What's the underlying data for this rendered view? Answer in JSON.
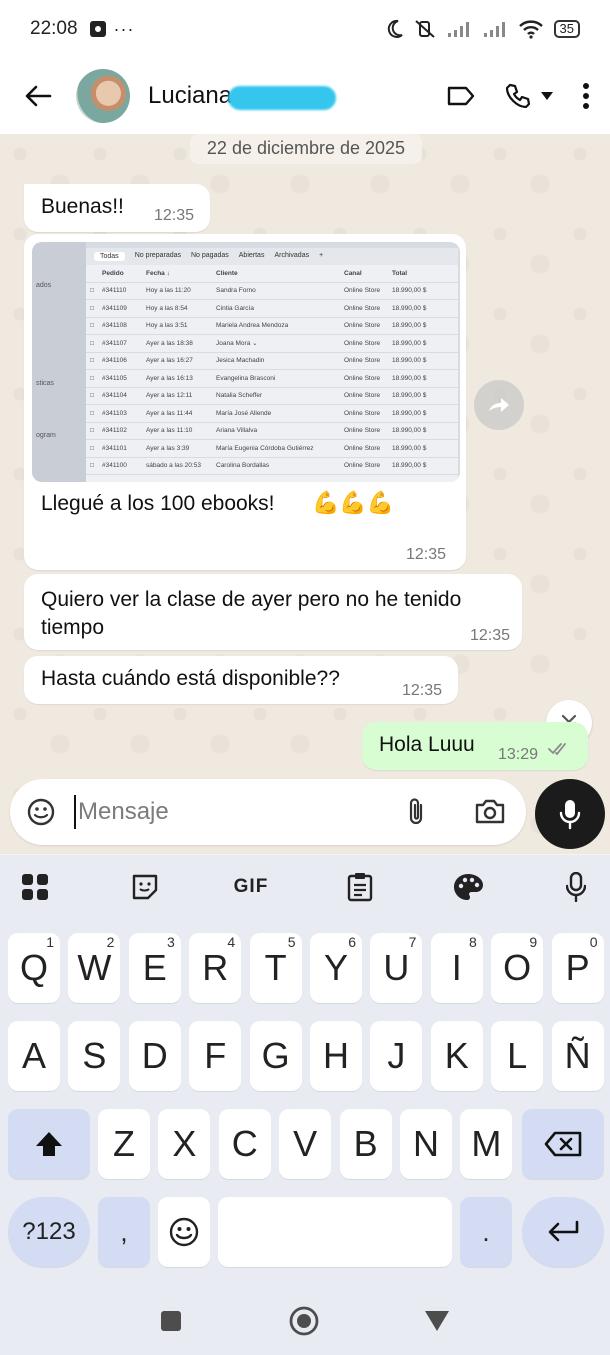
{
  "status_bar": {
    "time": "22:08",
    "dots": "···",
    "battery": "35"
  },
  "header": {
    "contact_name": "Luciana"
  },
  "chat": {
    "date": "22 de diciembre de 2025",
    "messages": [
      {
        "text": "Buenas!!",
        "time": "12:35"
      },
      {
        "caption": "Llegué a los 100 ebooks!",
        "emoji": "💪💪💪",
        "time": "12:35"
      },
      {
        "text": "Quiero ver la clase de ayer pero no he tenido tiempo",
        "time": "12:35"
      },
      {
        "text": "Hasta cuándo está disponible??",
        "time": "12:35"
      },
      {
        "text": "Hola Luuu",
        "time": "13:29",
        "outgoing": true
      }
    ],
    "screenshot_sheet": {
      "tabs": [
        "Todas",
        "No preparadas",
        "No pagadas",
        "Abiertas",
        "Archivadas",
        "+"
      ],
      "side_labels": [
        "ados",
        "sticas",
        "ogram"
      ],
      "columns": [
        "",
        "Pedido",
        "Fecha ↓",
        "Cliente",
        "Canal",
        "Total"
      ],
      "rows": [
        [
          "#341110",
          "Hoy a las 11:20",
          "Sandra Forno",
          "Online Store",
          "18.990,00 $"
        ],
        [
          "#341109",
          "Hoy a las 8:54",
          "Cintia García",
          "Online Store",
          "18.990,00 $"
        ],
        [
          "#341108",
          "Hoy a las 3:51",
          "Mariela Andrea Mendoza",
          "Online Store",
          "18.990,00 $"
        ],
        [
          "#341107",
          "Ayer a las 18:38",
          "Joana Mora ⌄",
          "Online Store",
          "18.990,00 $"
        ],
        [
          "#341106",
          "Ayer a las 16:27",
          "Jesica Machadin",
          "Online Store",
          "18.990,00 $"
        ],
        [
          "#341105",
          "Ayer a las 16:13",
          "Evangelina Brasconi",
          "Online Store",
          "18.990,00 $"
        ],
        [
          "#341104",
          "Ayer a las 12:11",
          "Natalia Scheffer",
          "Online Store",
          "18.990,00 $"
        ],
        [
          "#341103",
          "Ayer a las 11:44",
          "María José Allende",
          "Online Store",
          "18.990,00 $"
        ],
        [
          "#341102",
          "Ayer a las 11:10",
          "Ariana Villalva",
          "Online Store",
          "18.990,00 $"
        ],
        [
          "#341101",
          "Ayer a las 3:39",
          "María Eugenia Córdoba Gutiérrez",
          "Online Store",
          "18.990,00 $"
        ],
        [
          "#341100",
          "sábado a las 20:53",
          "Carolina Bordallas",
          "Online Store",
          "18.990,00 $"
        ]
      ]
    }
  },
  "composer": {
    "placeholder": "Mensaje"
  },
  "keyboard": {
    "toolbar_gif": "GIF",
    "row1": [
      [
        "Q",
        "1"
      ],
      [
        "W",
        "2"
      ],
      [
        "E",
        "3"
      ],
      [
        "R",
        "4"
      ],
      [
        "T",
        "5"
      ],
      [
        "Y",
        "6"
      ],
      [
        "U",
        "7"
      ],
      [
        "I",
        "8"
      ],
      [
        "O",
        "9"
      ],
      [
        "P",
        "0"
      ]
    ],
    "row2": [
      "A",
      "S",
      "D",
      "F",
      "G",
      "H",
      "J",
      "K",
      "L",
      "Ñ"
    ],
    "row3": [
      "Z",
      "X",
      "C",
      "V",
      "B",
      "N",
      "M"
    ],
    "symbols_key": "?123",
    "comma_key": ",",
    "period_key": "."
  },
  "colors": {
    "chat_bg": "#efe9e0",
    "incoming_bubble": "#ffffff",
    "outgoing_bubble": "#d9fdd3",
    "keyboard_bg": "#e9ebf3",
    "modifier_key": "#d3dcf3",
    "redaction": "#35c6ee"
  },
  "icons": [
    "back-arrow-icon",
    "label-icon",
    "phone-icon",
    "more-vert-icon",
    "forward-icon",
    "chevron-double-down-icon",
    "sticker-icon",
    "attach-icon",
    "camera-icon",
    "mic-icon",
    "apps-grid-icon",
    "clipboard-icon",
    "palette-icon",
    "shift-icon",
    "backspace-icon",
    "emoji-icon",
    "enter-icon",
    "nav-square-icon",
    "nav-home-icon",
    "nav-back-icon"
  ]
}
